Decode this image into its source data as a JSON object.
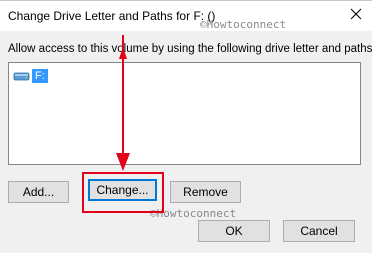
{
  "titlebar": {
    "title": "Change Drive Letter and Paths for F: ()",
    "close_label": "×"
  },
  "watermark_text": "©Howtoconnect",
  "dialog": {
    "instruction": "Allow access to this volume by using the following drive letter and paths:",
    "list_items": [
      {
        "label": "F:",
        "icon": "drive-icon",
        "selected": true
      }
    ],
    "buttons": {
      "add": "Add...",
      "change": "Change...",
      "remove": "Remove",
      "ok": "OK",
      "cancel": "Cancel"
    }
  },
  "colors": {
    "selection": "#3399ff",
    "highlight": "#e2001a",
    "default_button_border": "#0078d7"
  }
}
